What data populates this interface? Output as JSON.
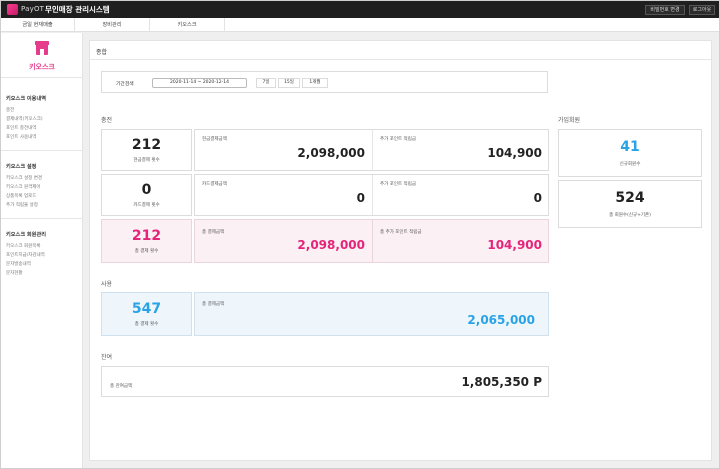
{
  "header": {
    "brand": "PayOT",
    "system_title": "무인매장 관리시스템",
    "password_button": "비밀번호 변경",
    "logout_button": "로그아웃"
  },
  "tabs": [
    "금일 현재매출",
    "장비관리",
    "키오스크"
  ],
  "sidebar": {
    "title": "키오스크",
    "sections": [
      {
        "heading": "키오스크 이용내역",
        "items": [
          "충전",
          "결제내역(키오스크)",
          "포인트 충전내역",
          "포인트 사용내역"
        ]
      },
      {
        "heading": "키오스크 설정",
        "items": [
          "키오스크 설정 변경",
          "키오스크 원격제어",
          "상품목록 업로드",
          "추가 적립율 설정"
        ]
      },
      {
        "heading": "키오스크 회원관리",
        "items": [
          "키오스크 회원목록",
          "포인트지급/차감내역",
          "문자발송내역",
          "문자현황"
        ]
      }
    ]
  },
  "main": {
    "title": "종합",
    "search": {
      "label": "기간검색",
      "date_range": "2020-11-14 ~ 2020-12-14",
      "buttons": [
        "7일",
        "15일",
        "1개월"
      ]
    },
    "charge": {
      "label": "충전",
      "row1": {
        "count": "212",
        "count_caption": "현금결제 횟수",
        "a_label": "현금결제금액",
        "a_value": "2,098,000",
        "b_label": "추가 포인트 적립금",
        "b_value": "104,900"
      },
      "row2": {
        "count": "0",
        "count_caption": "카드결제 횟수",
        "a_label": "카드결제금액",
        "a_value": "0",
        "b_label": "추가 포인트 적립금",
        "b_value": "0"
      },
      "row3": {
        "count": "212",
        "count_caption": "총 결제 횟수",
        "a_label": "총 결제금액",
        "a_value": "2,098,000",
        "b_label": "총 추가 포인트 적립금",
        "b_value": "104,900"
      }
    },
    "usage": {
      "label": "사용",
      "count": "547",
      "count_caption": "총 결제 횟수",
      "a_label": "총 결제금액",
      "a_value": "2,065,000"
    },
    "balance": {
      "label": "잔여",
      "a_label": "총 잔여금액",
      "a_value": "1,805,350 P"
    },
    "members": {
      "label": "가입회원",
      "new_count": "41",
      "new_caption": "신규회원수",
      "total_count": "524",
      "total_caption": "총 회원수(신규+기존)"
    }
  },
  "colors": {
    "accent_pink": "#e5247a",
    "accent_blue": "#29a3e6",
    "topbar": "#1f1f1f"
  }
}
